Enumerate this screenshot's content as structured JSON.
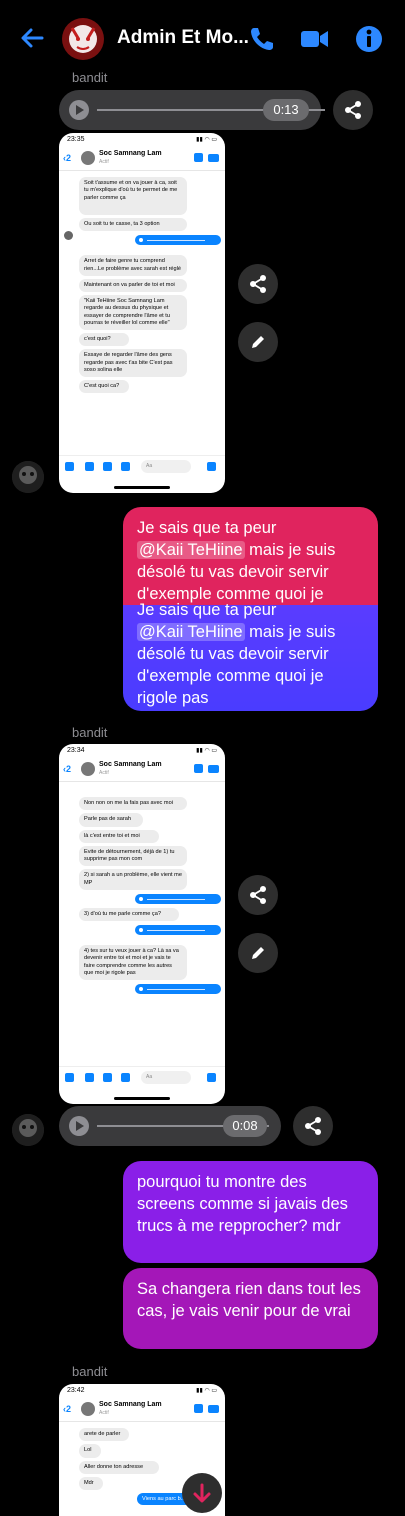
{
  "header": {
    "title": "Admin Et Mo..."
  },
  "messages": {
    "sender1": "bandit",
    "audio1_time": "0:13",
    "shot1": {
      "time": "23:35",
      "contact": "Soc Samnang Lam",
      "status": "Actif",
      "back_count": "2",
      "bubbles": [
        "Soit t'assume et on va jouer à ca, soit tu m'explique d'où tu te permet de me parler comme ça",
        "Ou soit tu te casse, ta 3 option",
        "Arret de faire genre tu comprend rien...Le problème avec sarah est réglé",
        "Maintenant on va parler de toi et moi",
        "\"Kaii TeHiine Soc Samnang Lam regarde au dessus du physique et essayer de comprendre l'âme et tu pourras te réveiller lol comme elle\"",
        "c'est quoi?",
        "Essaye de regarder l'âme des gens regarde pas avec t'as bite C'est pas soso solina elle",
        "C'est quoi ca?"
      ],
      "input_placeholder": "Aa"
    },
    "out1": {
      "line_before": "Je sais que ta peur",
      "mention": "@Kaii TeHiine",
      "line_after": " mais je suis désolé tu vas devoir servir d'exemple comme quoi je rigole pas",
      "overlap_text1": "Je sais que ta peur",
      "overlap_mention": "@Kaii TeHiine",
      "overlap_text2": " mais je suis désolé tu vas devoir servir d'exemple comme quoi je"
    },
    "sender2": "bandit",
    "shot2": {
      "time": "23:34",
      "contact": "Soc Samnang Lam",
      "status": "Actif",
      "back_count": "2",
      "bubbles": [
        "Non non on me la fais pas avec moi",
        "Parle pas de sarah",
        "là c'est entre toi et moi",
        "Evite de détournement, déjà de 1) tu supprime pas mon com",
        "2) si sarah a un problème, elle vient me MP",
        "3) d'où tu me parle comme ça?",
        "4) tes sur tu veux jouer à ca? Là sa va devenir entre toi et moi et je vais te faire comprendre comme les autres que moi je rigole pas"
      ],
      "input_placeholder": "Aa"
    },
    "audio2_time": "0:08",
    "out2": "pourquoi tu montre des screens comme si javais des trucs à me repprocher? mdr",
    "out3": "Sa changera rien dans tout les cas, je vais venir pour de vrai",
    "sender3": "bandit",
    "shot3": {
      "time": "23:42",
      "contact": "Soc Samnang Lam",
      "status": "Actif",
      "back_count": "2",
      "bubbles": [
        "arete de parler",
        "Lol",
        "Aller donne ton adresse",
        "Mdr"
      ],
      "blue_bubble": "Viens au parc b..."
    }
  },
  "colors": {
    "accent": "#0a84ff",
    "bubble_gradient_top": "#e0245e",
    "bubble_gradient_bottom": "#5a3cff",
    "bubble_purple": "#8a2be2",
    "bubble_magenta": "#b0179e"
  }
}
